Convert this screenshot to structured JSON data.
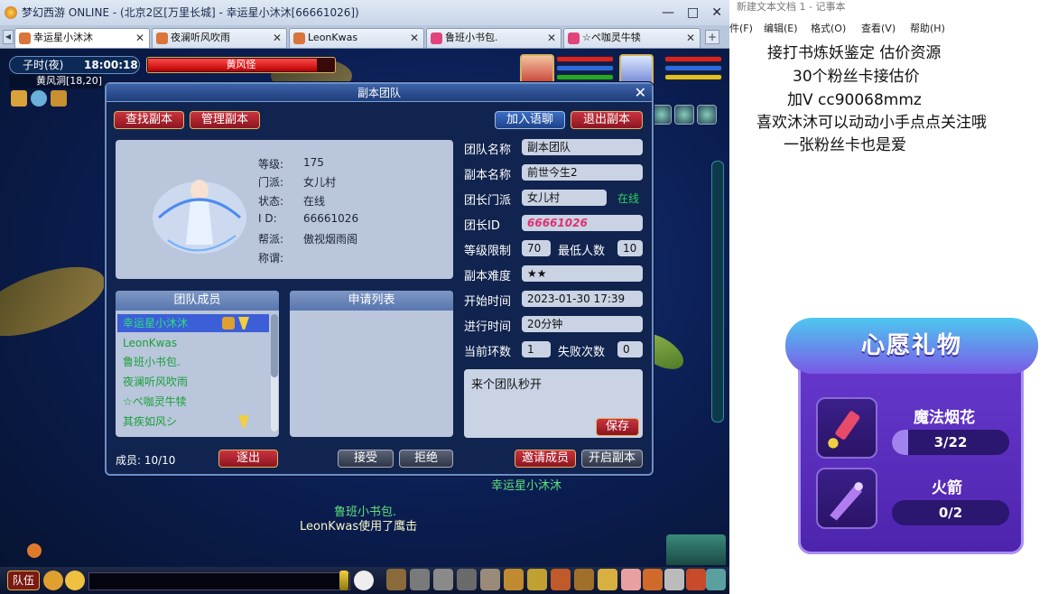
{
  "window": {
    "title": "梦幻西游 ONLINE - (北京2区[万里长城] - 幸运星小沐沐[66661026])",
    "min": "—",
    "max": "□",
    "close": "✕"
  },
  "tabs": [
    {
      "label": "幸运星小沐沐"
    },
    {
      "label": "夜澜听风吹雨"
    },
    {
      "label": "LeonKwas"
    },
    {
      "label": "鲁班小书包."
    },
    {
      "label": "☆ペ咖灵牛犊"
    }
  ],
  "hud": {
    "time_label": "子时(夜)",
    "time": "18:00:18",
    "location": "黄风洞[18,20]",
    "boss_name": "黄风怪",
    "boss_hp_fraction": 0.91
  },
  "scene_chat": [
    {
      "text": "幸运星小沐沐",
      "color": "green"
    },
    {
      "text": "鲁班小书包.",
      "color": "green"
    },
    {
      "text": "LeonKwas使用了鹰击",
      "color": "white"
    }
  ],
  "team_button": "队伍",
  "dialog": {
    "title": "副本团队",
    "close": "✕",
    "buttons": {
      "find": "查找副本",
      "manage": "管理副本",
      "join_chat": "加入语聊",
      "leave": "退出副本"
    },
    "char": {
      "labels": {
        "level": "等级:",
        "school": "门派:",
        "status": "状态:",
        "id": "I D:",
        "guild": "帮派:",
        "title": "称谓:"
      },
      "values": {
        "level": "175",
        "school": "女儿村",
        "status": "在线",
        "id": "66661026",
        "guild": "傲视烟雨阁",
        "title": ""
      }
    },
    "team": {
      "labels": {
        "name": "团队名称",
        "dungeon": "副本名称",
        "leader_school": "团长门派",
        "leader_id": "团长ID",
        "level_limit": "等级限制",
        "min_people": "最低人数",
        "difficulty": "副本难度",
        "start_time": "开始时间",
        "elapsed": "进行时间",
        "round": "当前环数",
        "fails": "失败次数"
      },
      "values": {
        "name": "副本团队",
        "dungeon": "前世今生2",
        "leader_school": "女儿村",
        "leader_status": "在线",
        "leader_id": "66661026",
        "level_limit": "70",
        "min_people": "10",
        "difficulty": "★★",
        "start_time": "2023-01-30 17:39",
        "elapsed": "20分钟",
        "round": "1",
        "fails": "0"
      }
    },
    "members_header": "团队成员",
    "members": [
      "幸运星小沐沐",
      "LeonKwas",
      "鲁班小书包.",
      "夜澜听风吹雨",
      "☆ペ咖灵牛犊",
      "其疾如风シ"
    ],
    "applications_header": "申请列表",
    "message": "来个团队秒开",
    "save": "保存",
    "member_count": "成员: 10/10",
    "footer": {
      "kick": "逐出",
      "accept": "接受",
      "reject": "拒绝",
      "invite": "邀请成员",
      "start": "开启副本"
    }
  },
  "notepad": {
    "title": "新建文本文档 1 - 记事本",
    "menu": [
      "件(F)",
      "编辑(E)",
      "格式(O)",
      "查看(V)",
      "帮助(H)"
    ],
    "lines": [
      "接打书炼妖鉴定 估价资源",
      "30个粉丝卡接估价",
      "加V   cc90068mmz",
      "喜欢沐沐可以动动小手点点关注哦",
      "一张粉丝卡也是爱"
    ]
  },
  "gift": {
    "title": "心愿礼物",
    "items": [
      {
        "name": "魔法烟花",
        "progress": "3/22",
        "fraction": 0.136
      },
      {
        "name": "火箭",
        "progress": "0/2",
        "fraction": 0
      }
    ]
  }
}
